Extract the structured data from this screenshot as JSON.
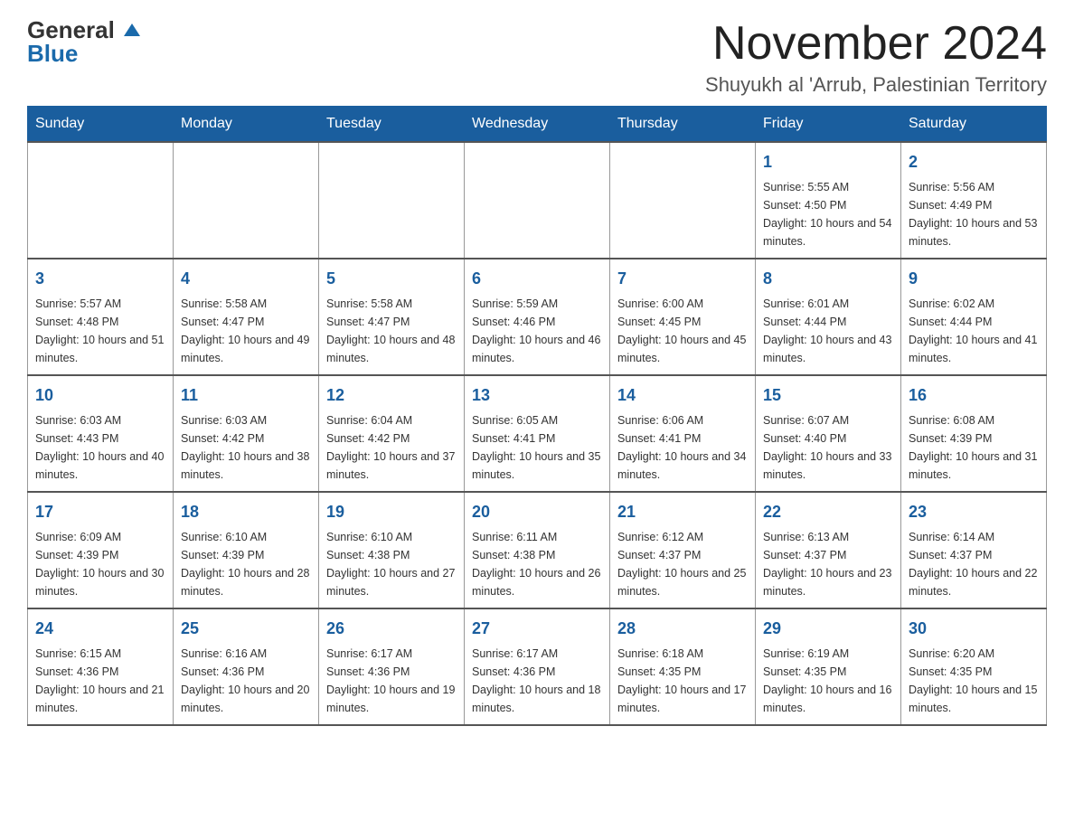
{
  "logo": {
    "general": "General",
    "blue": "Blue"
  },
  "header": {
    "month_year": "November 2024",
    "location": "Shuyukh al 'Arrub, Palestinian Territory"
  },
  "weekdays": [
    "Sunday",
    "Monday",
    "Tuesday",
    "Wednesday",
    "Thursday",
    "Friday",
    "Saturday"
  ],
  "weeks": [
    [
      {
        "day": "",
        "info": ""
      },
      {
        "day": "",
        "info": ""
      },
      {
        "day": "",
        "info": ""
      },
      {
        "day": "",
        "info": ""
      },
      {
        "day": "",
        "info": ""
      },
      {
        "day": "1",
        "info": "Sunrise: 5:55 AM\nSunset: 4:50 PM\nDaylight: 10 hours and 54 minutes."
      },
      {
        "day": "2",
        "info": "Sunrise: 5:56 AM\nSunset: 4:49 PM\nDaylight: 10 hours and 53 minutes."
      }
    ],
    [
      {
        "day": "3",
        "info": "Sunrise: 5:57 AM\nSunset: 4:48 PM\nDaylight: 10 hours and 51 minutes."
      },
      {
        "day": "4",
        "info": "Sunrise: 5:58 AM\nSunset: 4:47 PM\nDaylight: 10 hours and 49 minutes."
      },
      {
        "day": "5",
        "info": "Sunrise: 5:58 AM\nSunset: 4:47 PM\nDaylight: 10 hours and 48 minutes."
      },
      {
        "day": "6",
        "info": "Sunrise: 5:59 AM\nSunset: 4:46 PM\nDaylight: 10 hours and 46 minutes."
      },
      {
        "day": "7",
        "info": "Sunrise: 6:00 AM\nSunset: 4:45 PM\nDaylight: 10 hours and 45 minutes."
      },
      {
        "day": "8",
        "info": "Sunrise: 6:01 AM\nSunset: 4:44 PM\nDaylight: 10 hours and 43 minutes."
      },
      {
        "day": "9",
        "info": "Sunrise: 6:02 AM\nSunset: 4:44 PM\nDaylight: 10 hours and 41 minutes."
      }
    ],
    [
      {
        "day": "10",
        "info": "Sunrise: 6:03 AM\nSunset: 4:43 PM\nDaylight: 10 hours and 40 minutes."
      },
      {
        "day": "11",
        "info": "Sunrise: 6:03 AM\nSunset: 4:42 PM\nDaylight: 10 hours and 38 minutes."
      },
      {
        "day": "12",
        "info": "Sunrise: 6:04 AM\nSunset: 4:42 PM\nDaylight: 10 hours and 37 minutes."
      },
      {
        "day": "13",
        "info": "Sunrise: 6:05 AM\nSunset: 4:41 PM\nDaylight: 10 hours and 35 minutes."
      },
      {
        "day": "14",
        "info": "Sunrise: 6:06 AM\nSunset: 4:41 PM\nDaylight: 10 hours and 34 minutes."
      },
      {
        "day": "15",
        "info": "Sunrise: 6:07 AM\nSunset: 4:40 PM\nDaylight: 10 hours and 33 minutes."
      },
      {
        "day": "16",
        "info": "Sunrise: 6:08 AM\nSunset: 4:39 PM\nDaylight: 10 hours and 31 minutes."
      }
    ],
    [
      {
        "day": "17",
        "info": "Sunrise: 6:09 AM\nSunset: 4:39 PM\nDaylight: 10 hours and 30 minutes."
      },
      {
        "day": "18",
        "info": "Sunrise: 6:10 AM\nSunset: 4:39 PM\nDaylight: 10 hours and 28 minutes."
      },
      {
        "day": "19",
        "info": "Sunrise: 6:10 AM\nSunset: 4:38 PM\nDaylight: 10 hours and 27 minutes."
      },
      {
        "day": "20",
        "info": "Sunrise: 6:11 AM\nSunset: 4:38 PM\nDaylight: 10 hours and 26 minutes."
      },
      {
        "day": "21",
        "info": "Sunrise: 6:12 AM\nSunset: 4:37 PM\nDaylight: 10 hours and 25 minutes."
      },
      {
        "day": "22",
        "info": "Sunrise: 6:13 AM\nSunset: 4:37 PM\nDaylight: 10 hours and 23 minutes."
      },
      {
        "day": "23",
        "info": "Sunrise: 6:14 AM\nSunset: 4:37 PM\nDaylight: 10 hours and 22 minutes."
      }
    ],
    [
      {
        "day": "24",
        "info": "Sunrise: 6:15 AM\nSunset: 4:36 PM\nDaylight: 10 hours and 21 minutes."
      },
      {
        "day": "25",
        "info": "Sunrise: 6:16 AM\nSunset: 4:36 PM\nDaylight: 10 hours and 20 minutes."
      },
      {
        "day": "26",
        "info": "Sunrise: 6:17 AM\nSunset: 4:36 PM\nDaylight: 10 hours and 19 minutes."
      },
      {
        "day": "27",
        "info": "Sunrise: 6:17 AM\nSunset: 4:36 PM\nDaylight: 10 hours and 18 minutes."
      },
      {
        "day": "28",
        "info": "Sunrise: 6:18 AM\nSunset: 4:35 PM\nDaylight: 10 hours and 17 minutes."
      },
      {
        "day": "29",
        "info": "Sunrise: 6:19 AM\nSunset: 4:35 PM\nDaylight: 10 hours and 16 minutes."
      },
      {
        "day": "30",
        "info": "Sunrise: 6:20 AM\nSunset: 4:35 PM\nDaylight: 10 hours and 15 minutes."
      }
    ]
  ]
}
